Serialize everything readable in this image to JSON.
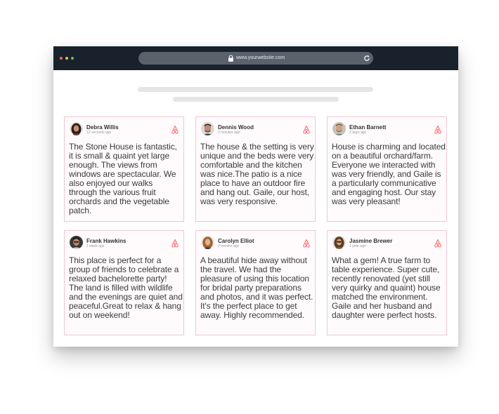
{
  "browser": {
    "url": "www.yourwebsite.com",
    "traffic_lights": [
      "#ed6a5e",
      "#f4be4f",
      "#61c454"
    ]
  },
  "colors": {
    "accent": "#ff5a5f",
    "card_border": "#f0c7d3",
    "card_bg": "#fffbfc"
  },
  "reviews": [
    {
      "name": "Debra Willis",
      "time": "12 seconds ago",
      "text": "The Stone House is fantastic, it is small & quaint yet large enough. The views from windows are spectacular. We also enjoyed our walks through the various fruit orchards and the vegetable patch.",
      "icon": "airbnb-icon"
    },
    {
      "name": "Dennis Wood",
      "time": "3 minutes ago",
      "text": "The house & the setting is very unique and the beds were very comfortable and the kitchen was nice.The patio is a nice place to have an outdoor fire and hang out. Gaile, our host, was very responsive.",
      "icon": "airbnb-icon"
    },
    {
      "name": "Ethan Barnett",
      "time": "2 days ago",
      "text": "House is charming and located on a beautiful orchard/farm. Everyone we interacted with was very friendly, and Gaile is a particularly communicative and engaging host. Our stay was very pleasant!",
      "icon": "airbnb-icon"
    },
    {
      "name": "Frank Hawkins",
      "time": "1 week ago",
      "text": "This place is perfect for a group of friends to celebrate a relaxed bachelorette party! The land is filled with wildlife and the evenings are quiet and peaceful.Great to relax & hang out on weekend!",
      "icon": "airbnb-icon"
    },
    {
      "name": "Carolyn Elliot",
      "time": "2 months ago",
      "text": "A beautiful hide away without the travel. We had the pleasure of using this location for bridal party preparations and photos, and it was perfect. It's the perfect place to get away. Highly recommended.",
      "icon": "airbnb-icon"
    },
    {
      "name": "Jasmine Brewer",
      "time": "1 year ago",
      "text": "What a gem! A true farm to table experience. Super cute, recently renovated (yet still very quirky and quaint) house matched the environment. Gaile and her husband and daughter were perfect hosts.",
      "icon": "airbnb-icon"
    }
  ]
}
